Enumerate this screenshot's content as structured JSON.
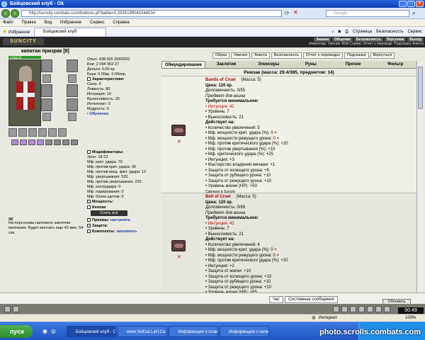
{
  "window": {
    "title": "Бойцовский клуб - Ok"
  },
  "address": {
    "url": "http://suncity.combats.com/buttons.pl?battle=0.293519904104603#",
    "search_placeholder": "Google"
  },
  "menu": [
    "Файл",
    "Правка",
    "Вид",
    "Избранное",
    "Сервис",
    "Справка"
  ],
  "favorites": {
    "label": "Избранное",
    "tab": "Бойцовский клуб",
    "tools": [
      "Страница",
      "Безопасность",
      "Сервис"
    ]
  },
  "game": {
    "logo": "SUNCITY",
    "topnav_row1": [
      "Знания",
      "Общение",
      "Безопасность",
      "Персонаж",
      "Выход"
    ],
    "topnav_row2": [
      "Инвентарь",
      "Умения",
      "Мой Сервис",
      "Отчет о переводе",
      "Подсказка",
      "Анкета"
    ]
  },
  "character": {
    "name": "капитан призрак [8]",
    "hp": "170/170",
    "exp": "Опыт: 438 026 (500000)",
    "battles": "Бои: 2 094   963   27",
    "money": "Деньги: 0.00 кр.",
    "bank": "Банк: 0.00кр. 0.00екр.",
    "sections": {
      "chars": "Характеристики:",
      "mods": "Модификаторы:",
      "powers": "Мощность:",
      "buttons": "Кнопки",
      "techniques": "Приемы:",
      "defense": "Защита:",
      "kits": "Комплекты:"
    },
    "stats": [
      "Сила: 3",
      "Ловкость: 80",
      "Интуиция: 10",
      "Выносливость: 25",
      "Интеллект: 0",
      "Мудрость: 0"
    ],
    "train": "• Обучение",
    "mods": [
      "Урон: 18-22",
      "Мф. крит. удара: 70",
      "Мф. против крит. удара: 30",
      "Мф. против мощ. крит. удара: 12",
      "Мф. увертывания: 520",
      "Мф. против увертывания: 230",
      "Мф. контрудара: 0",
      "Мф. парирования: 0",
      "Мф. блока щитом: 0"
    ],
    "dress_button": "Снять всё",
    "configure": "настроить",
    "remember": "запомнить",
    "spell_note": "На персонажа наложено заклятие молчания. Будет молчать еще 42 мин. 54 сек."
  },
  "rightnav": [
    "Образ",
    "Умения",
    "Анкета",
    "Безопасность",
    "Отчет о переводах",
    "Подсказка",
    "Вернуться"
  ],
  "tabs": [
    "Обмундирование",
    "Заклятия",
    "Эликсиры",
    "Руны",
    "Прочее",
    "Фильтр"
  ],
  "backpack": "Рюкзак (масса: 29.4/385, предметов: 14)",
  "items": [
    {
      "name": "Bands of Cruel",
      "mass": "(Масса: 5)",
      "price": "Цена: 120 кр.",
      "durability": "Долговечность: 0/55",
      "type": "Предмет для воина",
      "req_title": "Требуется минимальное:",
      "reqs": [
        "Интуиция: 42",
        "Уровень: 7",
        "Выносливость: 21"
      ],
      "acts_title": "Действует на:",
      "acts": [
        "Количество увелечений: 5",
        "Мф. мощности крит. удара (%): 0",
        "Мф. мощности режущего урона: 0",
        "Мф. против критического удара (%): +20",
        "Мф. против увертывания (%): +10",
        "Мф. критического удара (%): +25",
        "Интуиция: +3",
        "Мастерство владения мечами: +1",
        "Защита от колющего урона: +5",
        "Защита от рубящего урона: +10",
        "Защита от режущего урона: +10",
        "Уровень жизни (HP): +50"
      ],
      "made": "Сделано в Suncity"
    },
    {
      "name": "Belt of Cruel",
      "mass": "(Масса: 5)",
      "price": "Цена: 120 кр.",
      "durability": "Долговечность: 0/65",
      "type": "Предмет для воина",
      "req_title": "Требуется минимальное:",
      "reqs": [
        "Интуиция: 42",
        "Уровень: 7",
        "Выносливость: 21"
      ],
      "acts_title": "Действует на:",
      "acts": [
        "Количество увелечений: 4",
        "Мф. мощности крит. удара (%): 0",
        "Мф. мощности режущего урона: 0",
        "Мф. против критического удара (%): +20",
        "Интуиция: +2",
        "Защита от магии: +10",
        "Защита от колющего урона: +10",
        "Защита от рубящего урона: +10",
        "Защита от режущего урона: +10",
        "Уровень жизни (HP): +65"
      ],
      "made": ""
    }
  ],
  "chat": {
    "tabs": [
      "Чат",
      "Системные сообщения"
    ],
    "refresh": "Обновить",
    "clock": "00:49"
  },
  "status": {
    "zone": "Интернет",
    "zoom": "100%"
  },
  "taskbar": {
    "start": "пуск",
    "tasks": [
      "Бойцовский клуб - Ok",
      "www.SelDaLLaH.Co...",
      "Информация о клан...",
      "Информация о капи..."
    ]
  },
  "watermark": "photo.scrolls.combats.com"
}
